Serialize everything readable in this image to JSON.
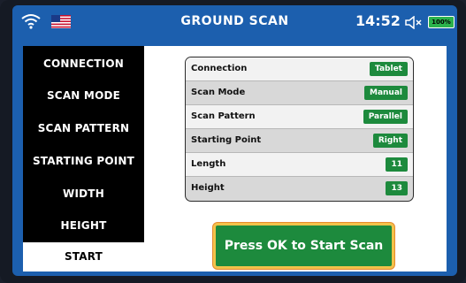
{
  "statusbar": {
    "title": "GROUND SCAN",
    "time": "14:52",
    "battery": "100%",
    "icons": [
      "wifi-icon",
      "us-flag-icon",
      "speaker-muted-icon",
      "battery-icon"
    ]
  },
  "sidebar": {
    "items": [
      {
        "label": "CONNECTION"
      },
      {
        "label": "SCAN MODE"
      },
      {
        "label": "SCAN PATTERN"
      },
      {
        "label": "STARTING POINT"
      },
      {
        "label": "WIDTH"
      },
      {
        "label": "HEIGHT"
      },
      {
        "label": "START"
      }
    ],
    "selected": "START"
  },
  "settings": {
    "rows": [
      {
        "label": "Connection",
        "value": "Tablet"
      },
      {
        "label": "Scan Mode",
        "value": "Manual"
      },
      {
        "label": "Scan Pattern",
        "value": "Parallel"
      },
      {
        "label": "Starting Point",
        "value": "Right"
      },
      {
        "label": "Length",
        "value": "11"
      },
      {
        "label": "Height",
        "value": "13"
      }
    ]
  },
  "action": {
    "start_label": "Press OK to Start Scan"
  },
  "colors": {
    "screen_blue": "#1c5fae",
    "value_green": "#1d8a3d",
    "button_border": "#f2c24a",
    "battery_green": "#2bb24c"
  }
}
